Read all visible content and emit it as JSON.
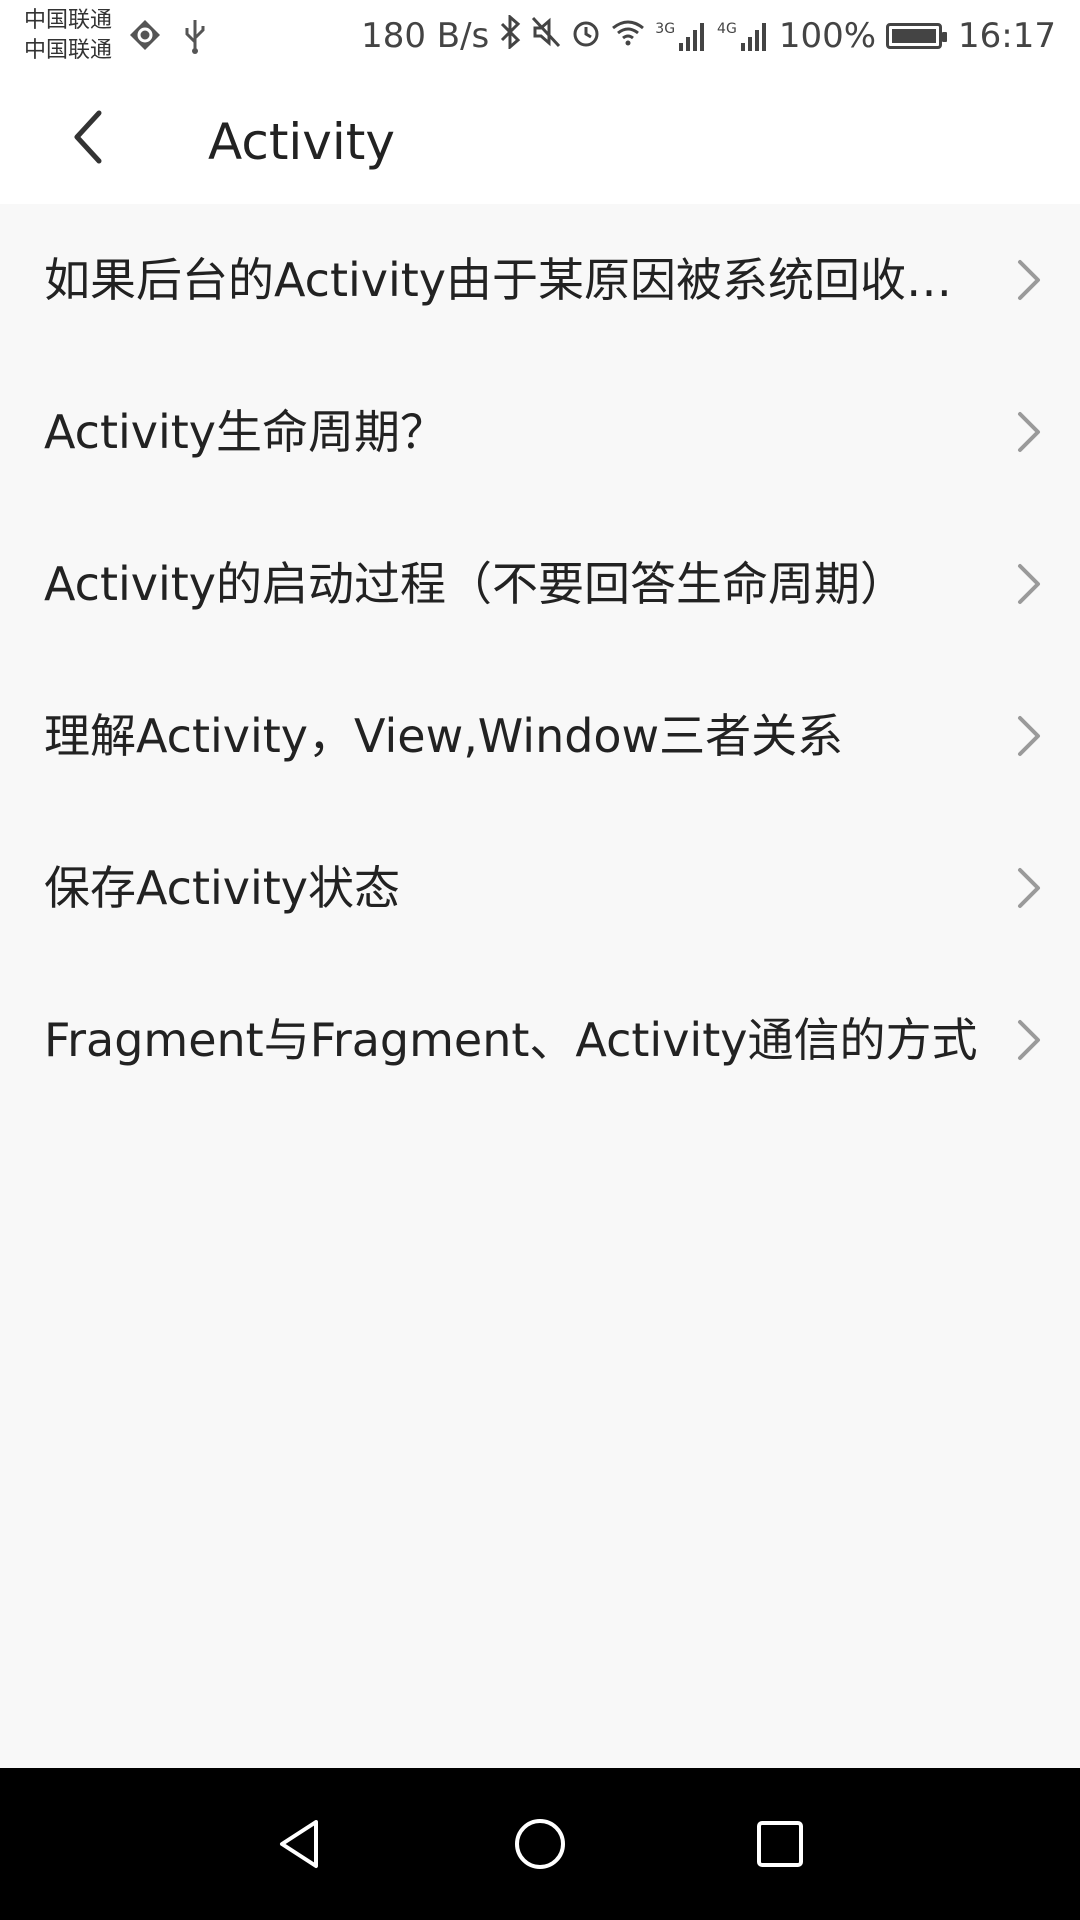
{
  "status_bar": {
    "carrier1": "中国联通",
    "carrier2": "中国联通",
    "speed": "180 B/s",
    "net1": "3G",
    "net2": "4G",
    "battery": "100%",
    "time": "16:17",
    "icons": [
      "vpn-icon",
      "usb-icon",
      "bluetooth-icon",
      "mute-icon",
      "alarm-icon",
      "wifi-icon",
      "signal-icon",
      "battery-icon"
    ]
  },
  "appbar": {
    "title": "Activity"
  },
  "list": {
    "items": [
      {
        "label": "如果后台的Activity由于某原因被系统回收了，如何在被系统回收之前保存当前状态？"
      },
      {
        "label": "Activity生命周期？"
      },
      {
        "label": "Activity的启动过程（不要回答生命周期）"
      },
      {
        "label": "理解Activity，View,Window三者关系"
      },
      {
        "label": "保存Activity状态"
      },
      {
        "label": "Fragment与Fragment、Activity通信的方式"
      }
    ]
  },
  "navbar": {
    "icons": [
      "nav-back-icon",
      "nav-home-icon",
      "nav-recents-icon"
    ]
  }
}
